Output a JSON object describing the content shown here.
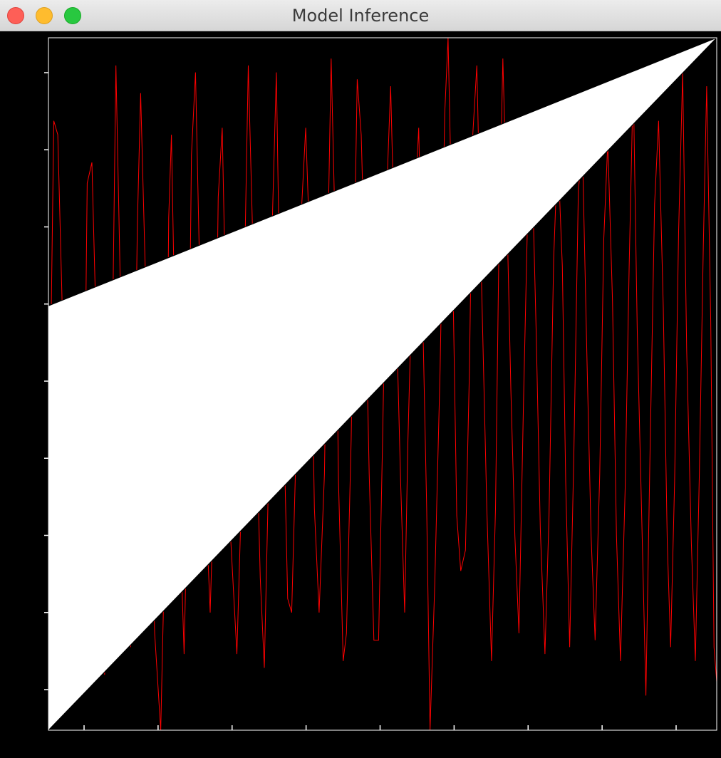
{
  "window": {
    "title": "Model Inference",
    "controls": {
      "close_icon": "close-icon",
      "minimize_icon": "minimize-icon",
      "maximize_icon": "maximize-icon"
    }
  },
  "colors": {
    "background": "#000000",
    "axes": "#ffffff",
    "signal": "#ff0000",
    "fill": "#ffffff",
    "close": "#fe5f57",
    "minimize": "#febc2e",
    "maximize": "#28c840"
  },
  "chart_data": {
    "type": "line",
    "title": "",
    "xlabel": "",
    "ylabel": "",
    "xlim": [
      0,
      1
    ],
    "ylim": [
      0,
      1
    ],
    "x_tick_count": 9,
    "y_tick_count": 9,
    "tick_labels_shown": false,
    "series": [
      {
        "color": "#ff0000",
        "x": [
          0.0,
          0.008,
          0.014,
          0.022,
          0.03,
          0.035,
          0.04,
          0.046,
          0.054,
          0.058,
          0.065,
          0.072,
          0.078,
          0.084,
          0.091,
          0.096,
          0.101,
          0.108,
          0.116,
          0.123,
          0.128,
          0.133,
          0.138,
          0.145,
          0.152,
          0.159,
          0.168,
          0.176,
          0.18,
          0.184,
          0.189,
          0.196,
          0.203,
          0.209,
          0.214,
          0.22,
          0.227,
          0.235,
          0.242,
          0.249,
          0.254,
          0.26,
          0.266,
          0.272,
          0.282,
          0.288,
          0.293,
          0.299,
          0.306,
          0.311,
          0.317,
          0.323,
          0.329,
          0.334,
          0.341,
          0.347,
          0.354,
          0.358,
          0.364,
          0.37,
          0.378,
          0.385,
          0.392,
          0.398,
          0.405,
          0.413,
          0.418,
          0.423,
          0.43,
          0.434,
          0.441,
          0.446,
          0.453,
          0.462,
          0.468,
          0.475,
          0.48,
          0.487,
          0.494,
          0.5,
          0.507,
          0.512,
          0.519,
          0.527,
          0.533,
          0.538,
          0.546,
          0.554,
          0.56,
          0.566,
          0.571,
          0.578,
          0.586,
          0.593,
          0.598,
          0.604,
          0.611,
          0.617,
          0.624,
          0.63,
          0.635,
          0.641,
          0.648,
          0.656,
          0.663,
          0.669,
          0.674,
          0.68,
          0.686,
          0.692,
          0.698,
          0.704,
          0.711,
          0.717,
          0.723,
          0.73,
          0.736,
          0.743,
          0.749,
          0.756,
          0.762,
          0.769,
          0.774,
          0.78,
          0.786,
          0.793,
          0.799,
          0.806,
          0.812,
          0.818,
          0.825,
          0.831,
          0.837,
          0.844,
          0.85,
          0.856,
          0.863,
          0.869,
          0.875,
          0.881,
          0.888,
          0.894,
          0.9,
          0.907,
          0.913,
          0.92,
          0.926,
          0.931,
          0.937,
          0.943,
          0.949,
          0.955,
          0.962,
          0.968,
          0.974,
          0.98,
          0.985,
          0.991,
          0.996,
          1.0
        ],
        "y": [
          0.3,
          0.88,
          0.86,
          0.56,
          0.38,
          0.22,
          0.15,
          0.2,
          0.44,
          0.79,
          0.82,
          0.56,
          0.3,
          0.08,
          0.26,
          0.58,
          0.96,
          0.62,
          0.28,
          0.12,
          0.38,
          0.73,
          0.92,
          0.66,
          0.4,
          0.14,
          0.0,
          0.35,
          0.74,
          0.86,
          0.59,
          0.33,
          0.11,
          0.38,
          0.83,
          0.95,
          0.63,
          0.34,
          0.17,
          0.4,
          0.77,
          0.87,
          0.58,
          0.29,
          0.11,
          0.31,
          0.64,
          0.96,
          0.7,
          0.45,
          0.22,
          0.09,
          0.35,
          0.7,
          0.95,
          0.58,
          0.36,
          0.19,
          0.17,
          0.39,
          0.74,
          0.87,
          0.67,
          0.32,
          0.17,
          0.37,
          0.7,
          0.97,
          0.68,
          0.36,
          0.1,
          0.14,
          0.42,
          0.94,
          0.86,
          0.61,
          0.37,
          0.13,
          0.13,
          0.42,
          0.8,
          0.93,
          0.66,
          0.36,
          0.17,
          0.42,
          0.71,
          0.87,
          0.6,
          0.32,
          0.0,
          0.21,
          0.52,
          0.89,
          1.0,
          0.72,
          0.31,
          0.23,
          0.26,
          0.52,
          0.86,
          0.96,
          0.65,
          0.32,
          0.1,
          0.32,
          0.69,
          0.97,
          0.75,
          0.49,
          0.28,
          0.14,
          0.48,
          0.74,
          0.84,
          0.57,
          0.29,
          0.11,
          0.31,
          0.68,
          0.84,
          0.67,
          0.36,
          0.12,
          0.39,
          0.78,
          0.84,
          0.53,
          0.28,
          0.13,
          0.37,
          0.71,
          0.85,
          0.62,
          0.28,
          0.1,
          0.35,
          0.67,
          0.94,
          0.58,
          0.3,
          0.05,
          0.39,
          0.76,
          0.88,
          0.61,
          0.27,
          0.12,
          0.36,
          0.72,
          0.95,
          0.55,
          0.27,
          0.1,
          0.37,
          0.7,
          0.93,
          0.59,
          0.12,
          0.07
        ]
      }
    ],
    "shapes": [
      {
        "type": "polygon",
        "fill": "#ffffff",
        "vertices": [
          [
            0.0,
            0.613
          ],
          [
            1.0,
            1.0
          ],
          [
            0.0,
            0.0
          ]
        ]
      }
    ]
  }
}
